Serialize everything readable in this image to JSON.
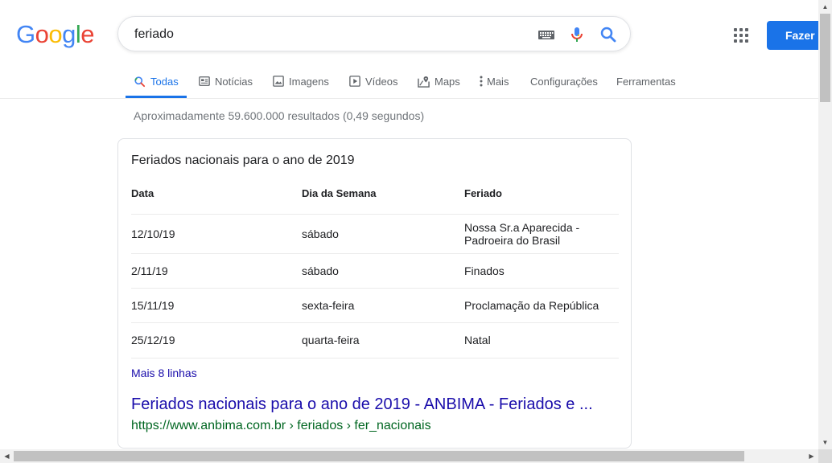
{
  "logo": [
    "G",
    "o",
    "o",
    "g",
    "l",
    "e"
  ],
  "colors": {
    "logo": [
      "#4285f4",
      "#ea4335",
      "#fbbc05",
      "#4285f4",
      "#34a853",
      "#ea4335"
    ],
    "accent": "#1a73e8",
    "link": "#1a0dab",
    "url": "#006621"
  },
  "search": {
    "query": "feriado",
    "icons": [
      "keyboard-icon",
      "microphone-icon",
      "search-icon"
    ]
  },
  "header": {
    "signin_label": "Fazer"
  },
  "tabs": [
    {
      "label": "Todas",
      "icon": "search-icon",
      "active": true
    },
    {
      "label": "Notícias",
      "icon": "news-icon"
    },
    {
      "label": "Imagens",
      "icon": "image-icon"
    },
    {
      "label": "Vídeos",
      "icon": "video-icon"
    },
    {
      "label": "Maps",
      "icon": "map-icon"
    },
    {
      "label": "Mais",
      "icon": "more-vert-icon"
    },
    {
      "label": "Configurações"
    },
    {
      "label": "Ferramentas"
    }
  ],
  "stats": "Aproximadamente 59.600.000 resultados (0,49 segundos)",
  "snippet": {
    "title": "Feriados nacionais para o ano de 2019",
    "headers": [
      "Data",
      "Dia da Semana",
      "Feriado"
    ],
    "rows": [
      [
        "12/10/19",
        "sábado",
        "Nossa Sr.a Aparecida - Padroeira do Brasil"
      ],
      [
        "2/11/19",
        "sábado",
        "Finados"
      ],
      [
        "15/11/19",
        "sexta-feira",
        "Proclamação da República"
      ],
      [
        "25/12/19",
        "quarta-feira",
        "Natal"
      ]
    ],
    "more_label": "Mais 8 linhas",
    "result_title": "Feriados nacionais para o ano de 2019 - ANBIMA - Feriados e ...",
    "result_url": "https://www.anbima.com.br › feriados › fer_nacionais"
  }
}
